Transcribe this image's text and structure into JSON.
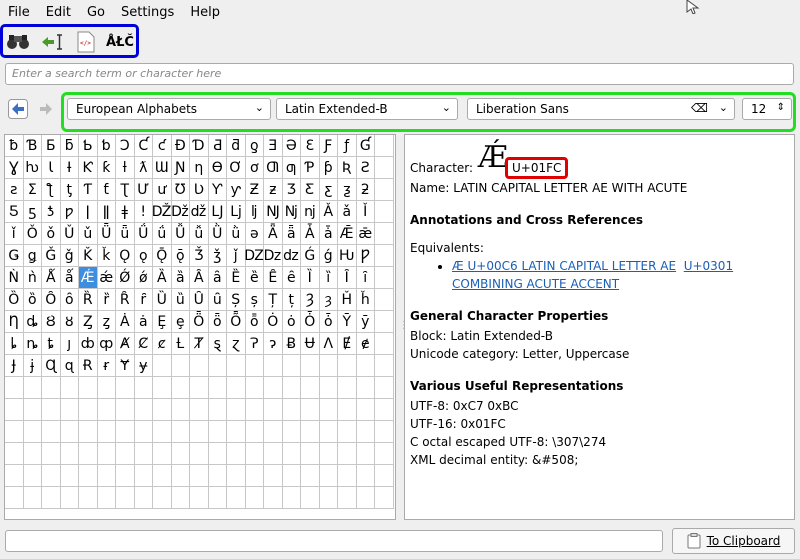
{
  "menu": [
    "File",
    "Edit",
    "Go",
    "Settings",
    "Help"
  ],
  "toolbar": {
    "format_label": "ÅŁČ"
  },
  "search": {
    "placeholder": "Enter a search term or character here"
  },
  "nav": {
    "category": "European Alphabets",
    "block": "Latin Extended-B",
    "font": "Liberation Sans",
    "size": "12"
  },
  "grid": {
    "rows": [
      [
        "ƀ",
        "Ɓ",
        "Ƃ",
        "ƃ",
        "Ƅ",
        "ƅ",
        "Ɔ",
        "Ƈ",
        "ƈ",
        "Ɖ",
        "Ɗ",
        "Ƌ",
        "ƌ",
        "ƍ",
        "Ǝ",
        "Ə",
        "Ɛ",
        "Ƒ",
        "ƒ",
        "Ɠ",
        ""
      ],
      [
        "Ɣ",
        "ƕ",
        "Ɩ",
        "Ɨ",
        "Ƙ",
        "ƙ",
        "ƚ",
        "ƛ",
        "Ɯ",
        "Ɲ",
        "ƞ",
        "Ɵ",
        "Ơ",
        "ơ",
        "Ƣ",
        "ƣ",
        "Ƥ",
        "ƥ",
        "Ʀ",
        "Ƨ",
        ""
      ],
      [
        "ƨ",
        "Ʃ",
        "ƪ",
        "ƫ",
        "Ƭ",
        "ƭ",
        "Ʈ",
        "Ư",
        "ư",
        "Ʊ",
        "Ʋ",
        "Ƴ",
        "ƴ",
        "Ƶ",
        "ƶ",
        "Ʒ",
        "Ƹ",
        "ƹ",
        "ƺ",
        "ƻ",
        ""
      ],
      [
        "Ƽ",
        "ƽ",
        "ƾ",
        "ƿ",
        "ǀ",
        "ǁ",
        "ǂ",
        "ǃ",
        "Ǆ",
        "ǅ",
        "ǆ",
        "Ǉ",
        "ǈ",
        "ǉ",
        "Ǌ",
        "ǋ",
        "ǌ",
        "Ǎ",
        "ǎ",
        "Ǐ",
        ""
      ],
      [
        "ǐ",
        "Ǒ",
        "ǒ",
        "Ǔ",
        "ǔ",
        "Ǖ",
        "ǖ",
        "Ǘ",
        "ǘ",
        "Ǚ",
        "ǚ",
        "Ǜ",
        "ǜ",
        "ǝ",
        "Ǟ",
        "ǟ",
        "Ǡ",
        "ǡ",
        "Ǣ",
        "ǣ",
        ""
      ],
      [
        "Ǥ",
        "ǥ",
        "Ǧ",
        "ǧ",
        "Ǩ",
        "ǩ",
        "Ǫ",
        "ǫ",
        "Ǭ",
        "ǭ",
        "Ǯ",
        "ǯ",
        "ǰ",
        "Ǳ",
        "ǲ",
        "ǳ",
        "Ǵ",
        "ǵ",
        "Ƕ",
        "Ƿ",
        ""
      ],
      [
        "Ǹ",
        "ǹ",
        "Ǻ",
        "ǻ",
        "Ǽ",
        "ǽ",
        "Ǿ",
        "ǿ",
        "Ȁ",
        "ȁ",
        "Ȃ",
        "ȃ",
        "Ȅ",
        "ȅ",
        "Ȇ",
        "ȇ",
        "Ȉ",
        "ȉ",
        "Ȋ",
        "ȋ",
        ""
      ],
      [
        "Ȍ",
        "ȍ",
        "Ȏ",
        "ȏ",
        "Ȑ",
        "ȑ",
        "Ȓ",
        "ȓ",
        "Ȕ",
        "ȕ",
        "Ȗ",
        "ȗ",
        "Ș",
        "ș",
        "Ț",
        "ț",
        "Ȝ",
        "ȝ",
        "Ȟ",
        "ȟ",
        ""
      ],
      [
        "Ƞ",
        "ȡ",
        "Ȣ",
        "ȣ",
        "Ȥ",
        "ȥ",
        "Ȧ",
        "ȧ",
        "Ȩ",
        "ȩ",
        "Ȫ",
        "ȫ",
        "Ȭ",
        "ȭ",
        "Ȯ",
        "ȯ",
        "Ȱ",
        "ȱ",
        "Ȳ",
        "ȳ",
        ""
      ],
      [
        "ȴ",
        "ȵ",
        "ȶ",
        "ȷ",
        "ȸ",
        "ȹ",
        "Ⱥ",
        "Ȼ",
        "ȼ",
        "Ƚ",
        "Ⱦ",
        "ȿ",
        "ɀ",
        "Ɂ",
        "ɂ",
        "Ƀ",
        "Ʉ",
        "Ʌ",
        "Ɇ",
        "ɇ",
        ""
      ],
      [
        "Ɉ",
        "ɉ",
        "Ɋ",
        "ɋ",
        "Ɍ",
        "ɍ",
        "Ɏ",
        "ɏ",
        "",
        "",
        "",
        "",
        "",
        "",
        "",
        "",
        "",
        "",
        "",
        "",
        ""
      ]
    ],
    "selected_row": 6,
    "selected_col": 4
  },
  "details": {
    "character_label": "Character:",
    "character": "Ǽ",
    "codepoint": "U+01FC",
    "name_line": "Name: LATIN CAPITAL LETTER AE WITH ACUTE",
    "annotations_heading": "Annotations and Cross References",
    "equivalents_label": "Equivalents:",
    "equiv_link1": "Æ U+00C6 LATIN CAPITAL LETTER AE",
    "equiv_link2": "U+0301 COMBINING ACUTE ACCENT",
    "general_heading": "General Character Properties",
    "block_line": "Block: Latin Extended-B",
    "category_line": "Unicode category: Letter, Uppercase",
    "various_heading": "Various Useful Representations",
    "utf8": "UTF-8: 0xC7 0xBC",
    "utf16": "UTF-16: 0x01FC",
    "coctal": "C octal escaped UTF-8: \\307\\274",
    "xml": "XML decimal entity: &#508;"
  },
  "clipboard": {
    "label": "To Clipboard"
  },
  "colors": {
    "highlight_blue": "#0000dd",
    "highlight_green": "#22dd22",
    "highlight_red": "#e00000",
    "selection": "#3d8ee0",
    "link": "#1a5fb4"
  }
}
